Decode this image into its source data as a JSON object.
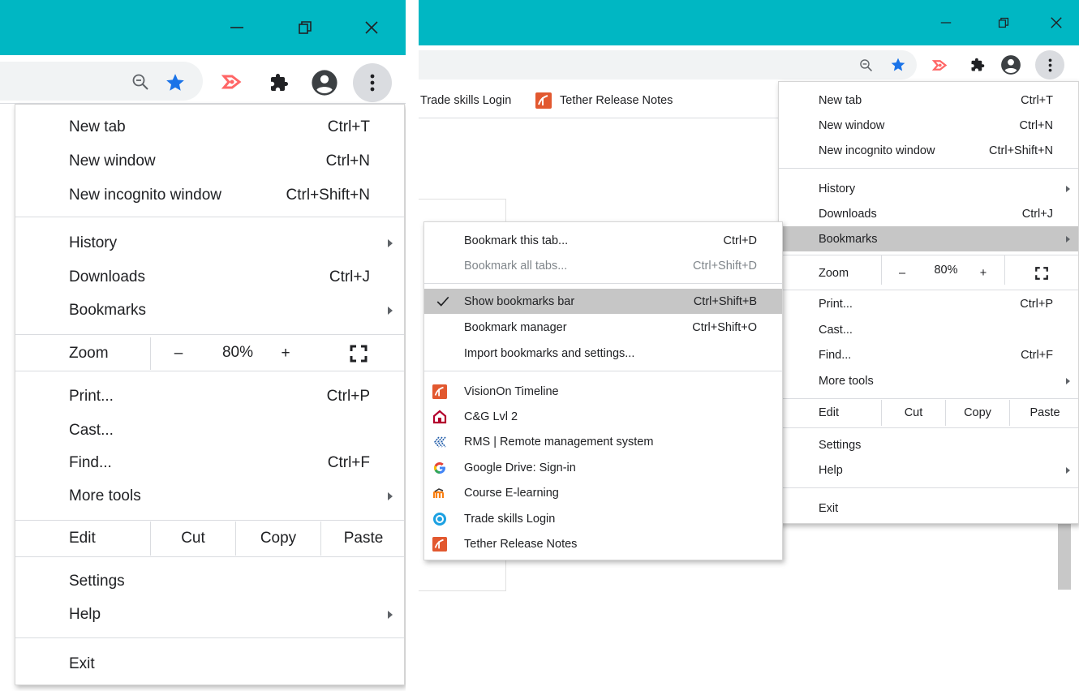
{
  "colors": {
    "titlebar": "#00b7c3",
    "menu_highlight": "#c6c6c6",
    "star": "#1a73e8"
  },
  "window_controls": {
    "minimize": "minimize-icon",
    "restore": "restore-icon",
    "close": "close-icon"
  },
  "toolbar_icons": [
    "zoom-out-icon",
    "bookmark-star-icon",
    "extension-arrow-icon",
    "puzzle-icon",
    "profile-icon",
    "kebab-menu-icon"
  ],
  "bookmarks_bar": {
    "items": [
      {
        "label": "Trade skills Login"
      },
      {
        "label": "Tether Release Notes",
        "icon": "tether-icon"
      }
    ]
  },
  "main_menu": {
    "new_tab": {
      "label": "New tab",
      "shortcut": "Ctrl+T"
    },
    "new_window": {
      "label": "New window",
      "shortcut": "Ctrl+N"
    },
    "new_incognito": {
      "label": "New incognito window",
      "shortcut": "Ctrl+Shift+N"
    },
    "history": {
      "label": "History"
    },
    "downloads": {
      "label": "Downloads",
      "shortcut": "Ctrl+J"
    },
    "bookmarks": {
      "label": "Bookmarks"
    },
    "zoom": {
      "label": "Zoom",
      "minus": "–",
      "value": "80%",
      "plus": "+"
    },
    "print": {
      "label": "Print...",
      "shortcut": "Ctrl+P"
    },
    "cast": {
      "label": "Cast..."
    },
    "find": {
      "label": "Find...",
      "shortcut": "Ctrl+F"
    },
    "more_tools": {
      "label": "More tools"
    },
    "edit": {
      "label": "Edit",
      "cut": "Cut",
      "copy": "Copy",
      "paste": "Paste"
    },
    "settings": {
      "label": "Settings"
    },
    "help": {
      "label": "Help"
    },
    "exit": {
      "label": "Exit"
    }
  },
  "bookmarks_submenu": {
    "bookmark_tab": {
      "label": "Bookmark this tab...",
      "shortcut": "Ctrl+D"
    },
    "bookmark_all": {
      "label": "Bookmark all tabs...",
      "shortcut": "Ctrl+Shift+D"
    },
    "show_bar": {
      "label": "Show bookmarks bar",
      "shortcut": "Ctrl+Shift+B",
      "checked": true
    },
    "manager": {
      "label": "Bookmark manager",
      "shortcut": "Ctrl+Shift+O"
    },
    "import": {
      "label": "Import bookmarks and settings..."
    },
    "items": [
      {
        "label": "VisionOn Timeline",
        "icon": "tether-icon"
      },
      {
        "label": "C&G Lvl 2",
        "icon": "cg-building-icon"
      },
      {
        "label": "RMS | Remote management system",
        "icon": "rms-chevron-icon"
      },
      {
        "label": "Google Drive: Sign-in",
        "icon": "google-g-icon"
      },
      {
        "label": "Course E-learning",
        "icon": "moodle-icon"
      },
      {
        "label": "Trade skills Login",
        "icon": "target-circle-icon"
      },
      {
        "label": "Tether Release Notes",
        "icon": "tether-icon"
      }
    ]
  }
}
